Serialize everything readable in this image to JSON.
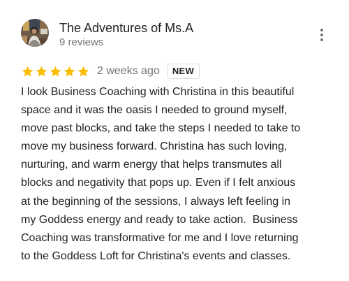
{
  "author": {
    "name": "The Adventures of Ms.A",
    "review_count": "9 reviews"
  },
  "review": {
    "rating": 5,
    "max_rating": 5,
    "date": "2 weeks ago",
    "badge": "NEW",
    "text": "I look Business Coaching with Christina in this beautiful\nspace and it was the oasis I needed to ground myself,\nmove past blocks, and take the steps I needed to take to\nmove my business forward. Christina has such loving,\nnurturing, and warm energy that helps transmutes all\nblocks and negativity that pops up. Even if I felt anxious\nat the beginning of the sessions, I always left feeling in\nmy Goddess energy and ready to take action.  Business\nCoaching was transformative for me and I love returning\nto the Goddess Loft for Christina's events and classes."
  },
  "icons": {
    "star": "star-icon",
    "more": "more-vert-icon"
  },
  "colors": {
    "star": "#fbbc04",
    "secondary_text": "#70757a",
    "primary_text": "#202124"
  }
}
